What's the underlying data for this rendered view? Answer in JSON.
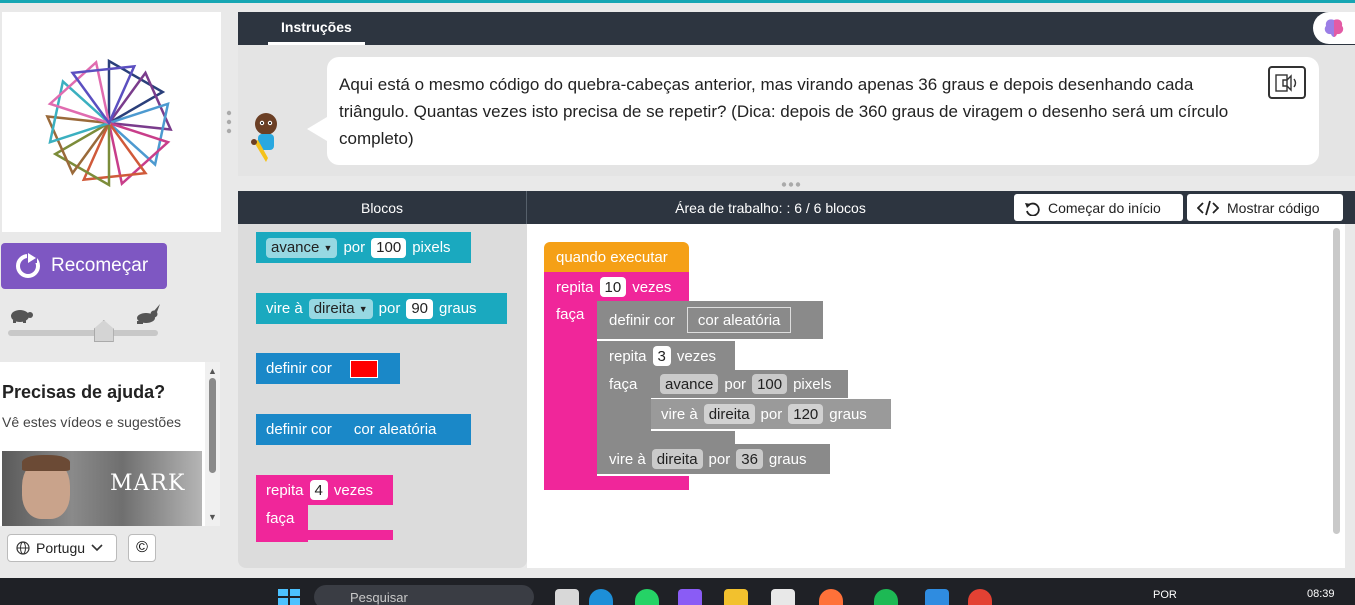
{
  "instructions": {
    "tab_label": "Instruções",
    "text": "Aqui está o mesmo código do quebra-cabeças anterior, mas virando apenas 36 graus e depois desenhando cada triângulo. Quantas vezes isto precisa de se repetir? (Dica: depois de 360 graus de viragem o desenho será um círculo completo)"
  },
  "left": {
    "restart_label": "Recomeçar",
    "speed_level": 0.66,
    "help_title": "Precisas de ajuda?",
    "help_subtitle": "Vê estes vídeos e sugestões",
    "video_caption": "MARK",
    "language": "Portugu",
    "copyright_symbol": "©"
  },
  "workspace_header": {
    "blocks_title": "Blocos",
    "area_title": "Área de trabalho: : 6 / 6 blocos",
    "start_over_label": "Começar do início",
    "show_code_label": "Mostrar código"
  },
  "toolbox": {
    "move": {
      "verb": "avance",
      "by": "por",
      "value": "100",
      "unit": "pixels"
    },
    "turn": {
      "verb": "vire à",
      "dir": "direita",
      "by": "por",
      "value": "90",
      "unit": "graus"
    },
    "set_color": {
      "label": "definir cor",
      "color": "#ff0000"
    },
    "set_random_color": {
      "label": "definir cor",
      "value": "cor aleatória"
    },
    "repeat": {
      "label": "repita",
      "value": "4",
      "unit": "vezes",
      "do": "faça"
    }
  },
  "program": {
    "when_run": "quando executar",
    "outer_repeat": {
      "label": "repita",
      "value": "10",
      "unit": "vezes",
      "do": "faça"
    },
    "set_color": {
      "label": "definir cor",
      "value": "cor aleatória"
    },
    "inner_repeat": {
      "label": "repita",
      "value": "3",
      "unit": "vezes",
      "do": "faça"
    },
    "move": {
      "verb": "avance",
      "by": "por",
      "value": "100",
      "unit": "pixels"
    },
    "turn_inner": {
      "verb": "vire à",
      "dir": "direita",
      "by": "por",
      "value": "120",
      "unit": "graus"
    },
    "turn_outer": {
      "verb": "vire à",
      "dir": "direita",
      "by": "por",
      "value": "36",
      "unit": "graus"
    }
  },
  "taskbar": {
    "search_placeholder": "Pesquisar",
    "language": "POR",
    "time": "08:39"
  },
  "colors": {
    "move_block": "#1aa9bf",
    "color_block": "#1a88c8",
    "loop_block": "#f0269a",
    "event_block": "#f5a016",
    "restart_button": "#7e57c2"
  }
}
